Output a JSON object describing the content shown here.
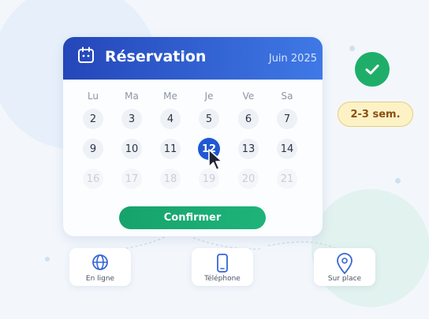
{
  "header": {
    "title": "Réservation",
    "month": "Juin 2025",
    "icon": "calendar-icon"
  },
  "weekdays": [
    "Lu",
    "Ma",
    "Me",
    "Je",
    "Ve",
    "Sa"
  ],
  "weeks": [
    [
      "2",
      "3",
      "4",
      "5",
      "6",
      "7"
    ],
    [
      "9",
      "10",
      "11",
      "12",
      "13",
      "14"
    ],
    [
      "16",
      "17",
      "18",
      "19",
      "20",
      "21"
    ]
  ],
  "selected_day": "12",
  "confirm_label": "Confirmer",
  "status": {
    "icon": "check-icon"
  },
  "delay_badge": "2-3 sem.",
  "options": [
    {
      "label": "En ligne",
      "icon": "globe-icon"
    },
    {
      "label": "Téléphone",
      "icon": "phone-icon"
    },
    {
      "label": "Sur place",
      "icon": "map-pin-icon"
    }
  ],
  "colors": {
    "header_start": "#2446b9",
    "header_end": "#3f79e6",
    "selected": "#2058d4",
    "confirm": "#16a36b",
    "success": "#1fae6a",
    "badge_bg": "#fcf2c6",
    "badge_text": "#8a4e12"
  }
}
